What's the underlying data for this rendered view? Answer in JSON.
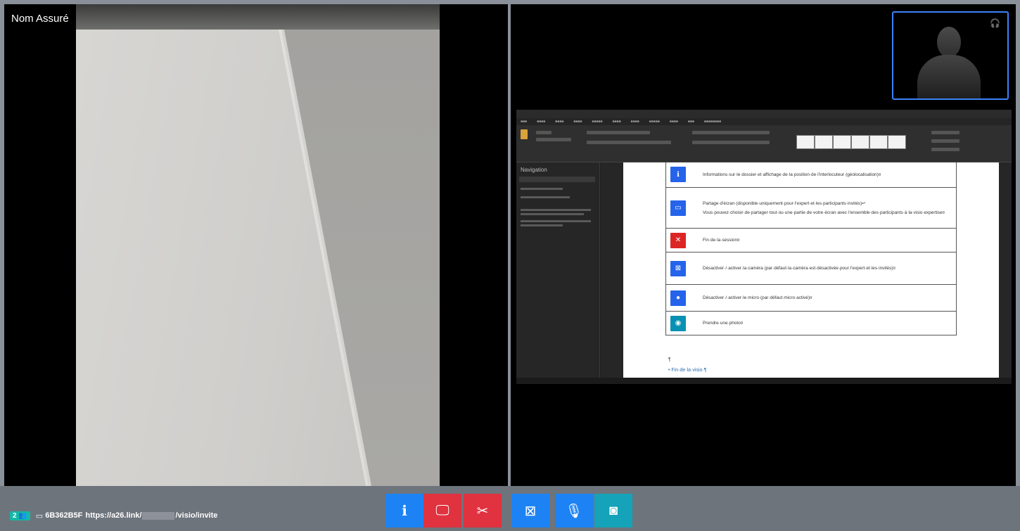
{
  "left_pane": {
    "participant_name": "Nom Assuré"
  },
  "right_pane": {
    "document": {
      "rows": [
        {
          "icon": "info-icon",
          "color": "#2563eb",
          "glyph": "ℹ",
          "text": "Informations·sur·le·dossier·et·affichage·de·la·position·de·l'interlocuteur·(géolocalisation)¤"
        },
        {
          "icon": "screen-share-icon",
          "color": "#2563eb",
          "glyph": "▭",
          "text": "Partage·d'écran·(disponible·uniquement·pour·l'expert·et·les·participants·invités)↵ Vous·pouvez·choisir·de·partager·tout·ou·une·partie·de·votre·écran·avec·l'ensemble·des·participants·à·la·visio·expertise¤"
        },
        {
          "icon": "hang-up-icon",
          "color": "#dc2626",
          "glyph": "✕",
          "text": "Fin·de·la·session¤"
        },
        {
          "icon": "camera-off-icon",
          "color": "#2563eb",
          "glyph": "⊠",
          "text": "Désactiver·/·activer·la·caméra·(par·défaut·la·caméra·est·désactivée·pour·l'expert·et·les·invités)¤"
        },
        {
          "icon": "microphone-icon",
          "color": "#2563eb",
          "glyph": "●",
          "text": "Désactiver·/·activer·le·micro·(par·défaut·micro·activé)¤"
        },
        {
          "icon": "photo-camera-icon",
          "color": "#0891b2",
          "glyph": "◉",
          "text": "Prendre·une·photo¤"
        }
      ],
      "after_para": "¶",
      "after_heading": "• Fin·de·la·visio·¶"
    }
  },
  "toolbar": {
    "participant_count": "2",
    "session_code": "6B362B5F",
    "link_prefix": "https://a26.link/",
    "link_suffix": "/visio/invite",
    "buttons": [
      {
        "name": "info-button",
        "icon": "info-icon",
        "glyph": "ℹ",
        "color": "#1d83f4"
      },
      {
        "name": "share-screen-button",
        "icon": "screen-share-icon",
        "glyph": "🖵",
        "color": "#e0323f"
      },
      {
        "name": "hang-up-button",
        "icon": "hang-up-icon",
        "glyph": "✂",
        "color": "#e0323f"
      },
      {
        "name": "camera-toggle-button",
        "icon": "camera-off-icon",
        "glyph": "⊠",
        "color": "#1d83f4"
      },
      {
        "name": "microphone-toggle-button",
        "icon": "microphone-icon",
        "glyph": "🎙",
        "color": "#1d83f4"
      },
      {
        "name": "take-photo-button",
        "icon": "photo-camera-icon",
        "glyph": "◙",
        "color": "#14a3b8"
      }
    ]
  }
}
